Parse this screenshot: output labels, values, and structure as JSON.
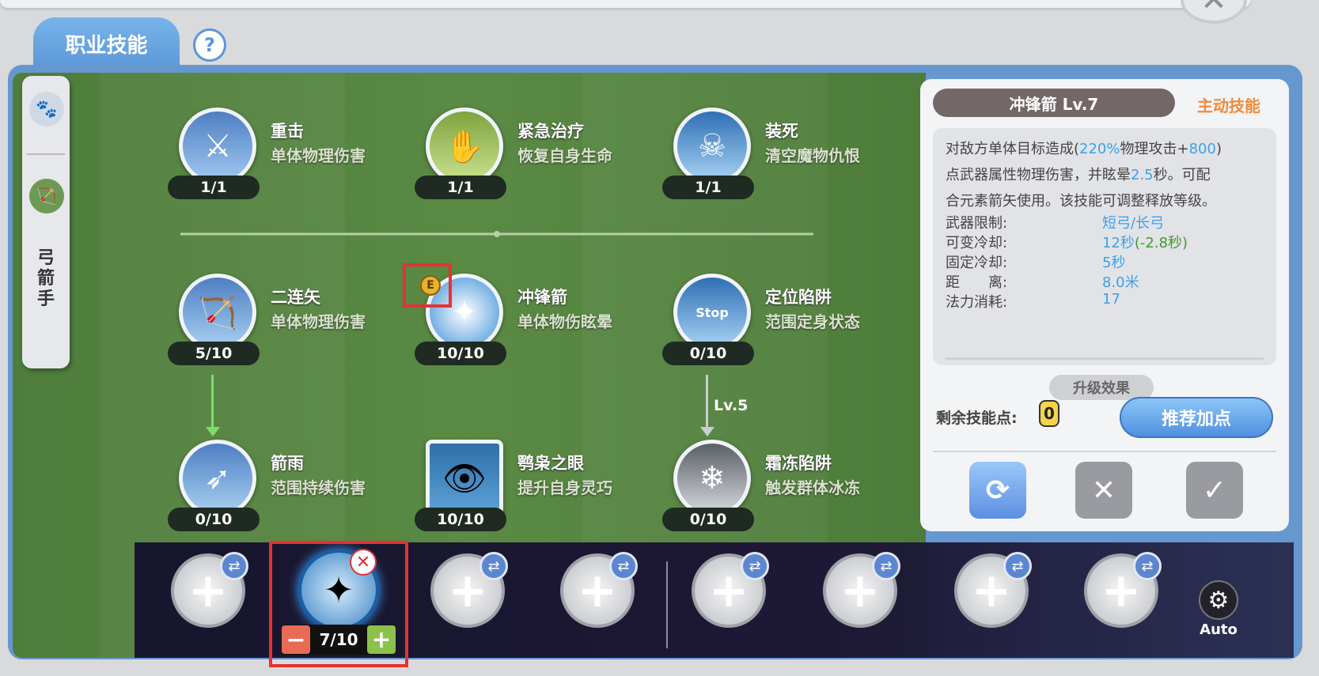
{
  "header": {
    "tab_label": "职业技能",
    "help_label": "?",
    "close_label": "✕"
  },
  "side": {
    "job_label": "弓箭手",
    "icon1": "pet-icon",
    "icon2": "bow-icon"
  },
  "skills": [
    {
      "name": "重击",
      "desc": "单体物理伤害",
      "level": "1/1",
      "icon": "sword-icon"
    },
    {
      "name": "紧急治疗",
      "desc": "恢复自身生命",
      "level": "1/1",
      "icon": "hand-icon"
    },
    {
      "name": "装死",
      "desc": "清空魔物仇恨",
      "level": "1/1",
      "icon": "fake-death-icon"
    },
    {
      "name": "二连矢",
      "desc": "单体物理伤害",
      "level": "5/10",
      "icon": "double-arrow-icon"
    },
    {
      "name": "冲锋箭",
      "desc": "单体物伤眩晕",
      "level": "10/10",
      "icon": "charge-arrow-icon"
    },
    {
      "name": "定位陷阱",
      "desc": "范围定身状态",
      "level": "0/10",
      "icon": "stop-trap-icon"
    },
    {
      "name": "箭雨",
      "desc": "范围持续伤害",
      "level": "0/10",
      "icon": "arrow-rain-icon"
    },
    {
      "name": "鹗枭之眼",
      "desc": "提升自身灵巧",
      "level": "10/10",
      "icon": "eye-icon"
    },
    {
      "name": "霜冻陷阱",
      "desc": "触发群体冰冻",
      "level": "0/10",
      "icon": "frost-trap-icon"
    }
  ],
  "tree_labels": {
    "lv_requirement": "Lv.5",
    "e_badge": "E"
  },
  "detail": {
    "title": "冲锋箭 Lv.7",
    "type": "主动技能",
    "desc_a": "对敌方单体目标造成(",
    "desc_pct": "220%",
    "desc_b": "物理攻击+",
    "desc_num": "800",
    "desc_c": ")",
    "desc_d": "点武器属性物理伤害，并眩晕",
    "desc_sec": "2.5",
    "desc_e": "秒。可配",
    "desc_f": "合元素箭矢使用。该技能可调整释放等级。",
    "stats": [
      {
        "key": "武器限制:",
        "value": "短弓/长弓",
        "extra": ""
      },
      {
        "key": "可变冷却:",
        "value": "12秒",
        "extra": "(-2.8秒)"
      },
      {
        "key": "固定冷却:",
        "value": "5秒",
        "extra": ""
      },
      {
        "key": "距　　离:",
        "value": "8.0米",
        "extra": ""
      },
      {
        "key": "法力消耗:",
        "value": "17",
        "extra": ""
      }
    ],
    "upgrade_label": "升级效果",
    "points_label": "剩余技能点:",
    "points_value": "0",
    "recommend_label": "推荐加点"
  },
  "hotbar": {
    "stepper_value": "7/10",
    "minus_label": "−",
    "plus_label": "+",
    "auto_label": "Auto"
  },
  "colors": {
    "accent": "#5b97d8",
    "skill_type": "#f08a3c",
    "highlight": "#3ea0e8",
    "cooldown_reduction": "#3d9a2f"
  }
}
